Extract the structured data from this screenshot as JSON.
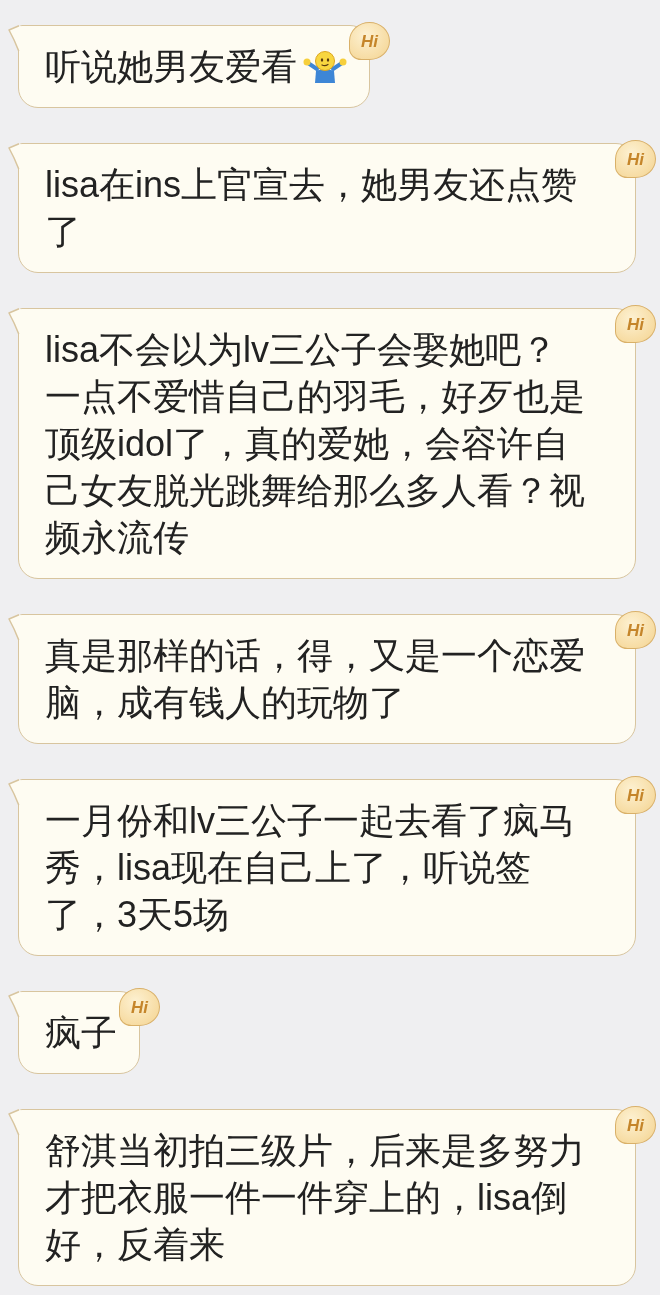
{
  "messages": [
    {
      "lines": [
        "听说她男友爱看"
      ],
      "emoji": true,
      "badge": "Hi"
    },
    {
      "lines": [
        "lisa在ins上官宣去，她男友还点赞",
        "了"
      ],
      "emoji": false,
      "badge": "Hi"
    },
    {
      "lines": [
        "lisa不会以为lv三公子会娶她吧？",
        "一点不爱惜自己的羽毛，好歹也是",
        "顶级idol了，真的爱她，会容许自",
        "己女友脱光跳舞给那么多人看？视",
        "频永流传"
      ],
      "emoji": false,
      "badge": "Hi"
    },
    {
      "lines": [
        "真是那样的话，得，又是一个恋爱",
        "脑，成有钱人的玩物了"
      ],
      "emoji": false,
      "badge": "Hi"
    },
    {
      "lines": [
        "一月份和lv三公子一起去看了疯马",
        "秀，lisa现在自己上了，听说签",
        "了，3天5场"
      ],
      "emoji": false,
      "badge": "Hi"
    },
    {
      "lines": [
        "疯子"
      ],
      "emoji": false,
      "badge": "Hi"
    },
    {
      "lines": [
        "舒淇当初拍三级片，后来是多努力",
        "才把衣服一件一件穿上的，lisa倒",
        "好，反着来"
      ],
      "emoji": false,
      "badge": "Hi"
    }
  ]
}
